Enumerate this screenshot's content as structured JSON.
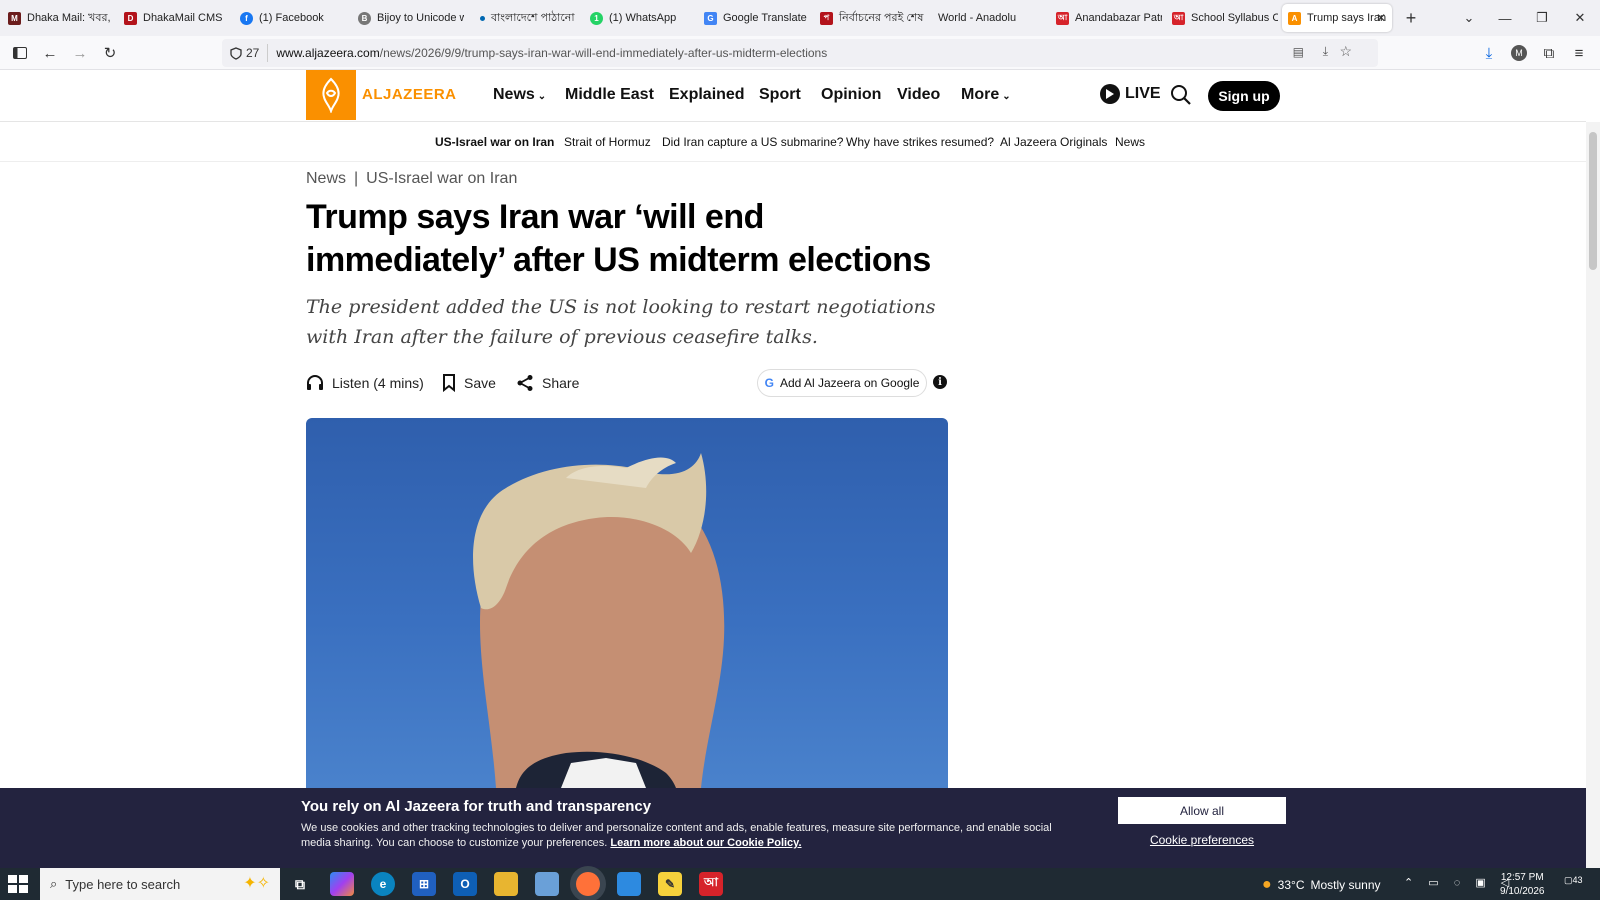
{
  "browser": {
    "tabs": [
      {
        "label": "Dhaka Mail: খবর, ব",
        "color": "#6b1c1c"
      },
      {
        "label": "DhakaMail CMS",
        "color": "#b3131b"
      },
      {
        "label": "(1) Facebook",
        "color": "#1877f2"
      },
      {
        "label": "Bijoy to Unicode w",
        "color": "#555555"
      },
      {
        "label": "বাংলাদেশে পাঠানো",
        "color": "#0067b1"
      },
      {
        "label": "(1) WhatsApp",
        "color": "#25d366"
      },
      {
        "label": "Google Translate",
        "color": "#4285f4"
      },
      {
        "label": "নির্বাচনের পরই শেষ",
        "color": "#b3131b"
      },
      {
        "label": "World - Anadolu",
        "color": "#cc2229"
      },
      {
        "label": "Anandabazar Patri",
        "color": "#d6232a"
      },
      {
        "label": "School Syllabus Ch",
        "color": "#d6232a"
      },
      {
        "label": "Trump says Iran",
        "color": "#fa9000"
      }
    ],
    "new_tab": "+",
    "tracker_count": "27",
    "url_domain": "www.aljazeera.com",
    "url_path": "/news/2026/9/9/trump-says-iran-war-will-end-immediately-after-us-midterm-elections",
    "profile_initial": "M"
  },
  "site": {
    "logo_text": "ALJAZEERA",
    "nav": [
      "News",
      "Middle East",
      "Explained",
      "Sport",
      "Opinion",
      "Video",
      "More"
    ],
    "live_label": "LIVE",
    "signup_label": "Sign up",
    "subnav": [
      "US-Israel war on Iran",
      "Strait of Hormuz",
      "Did Iran capture a US submarine?",
      "Why have strikes resumed?",
      "Al Jazeera Originals",
      "News"
    ],
    "brand_color": "#fa9000"
  },
  "article": {
    "breadcrumb_section": "News",
    "breadcrumb_sep": "|",
    "breadcrumb_topic": "US-Israel war on Iran",
    "headline": "Trump says Iran war ‘will end immediately’ after US midterm elections",
    "subhead": "The president added the US is not looking to restart negotiations with Iran after the failure of previous ceasefire talks.",
    "listen_label": "Listen (4 mins)",
    "save_label": "Save",
    "share_label": "Share",
    "google_label": "Add Al Jazeera on Google"
  },
  "cookie": {
    "title": "You rely on Al Jazeera for truth and transparency",
    "body": "We use cookies and other tracking technologies to deliver and personalize content and ads, enable features, measure site performance, and enable social media sharing. You can choose to customize your preferences.",
    "link": "Learn more about our Cookie Policy.",
    "allow_all": "Allow all",
    "preferences": "Cookie preferences",
    "bg_color": "#23233f"
  },
  "taskbar": {
    "search_placeholder": "Type here to search",
    "weather_temp": "33°C",
    "weather_text": "Mostly sunny",
    "time": "12:57 PM",
    "date": "9/10/2026",
    "notifications": "43"
  }
}
